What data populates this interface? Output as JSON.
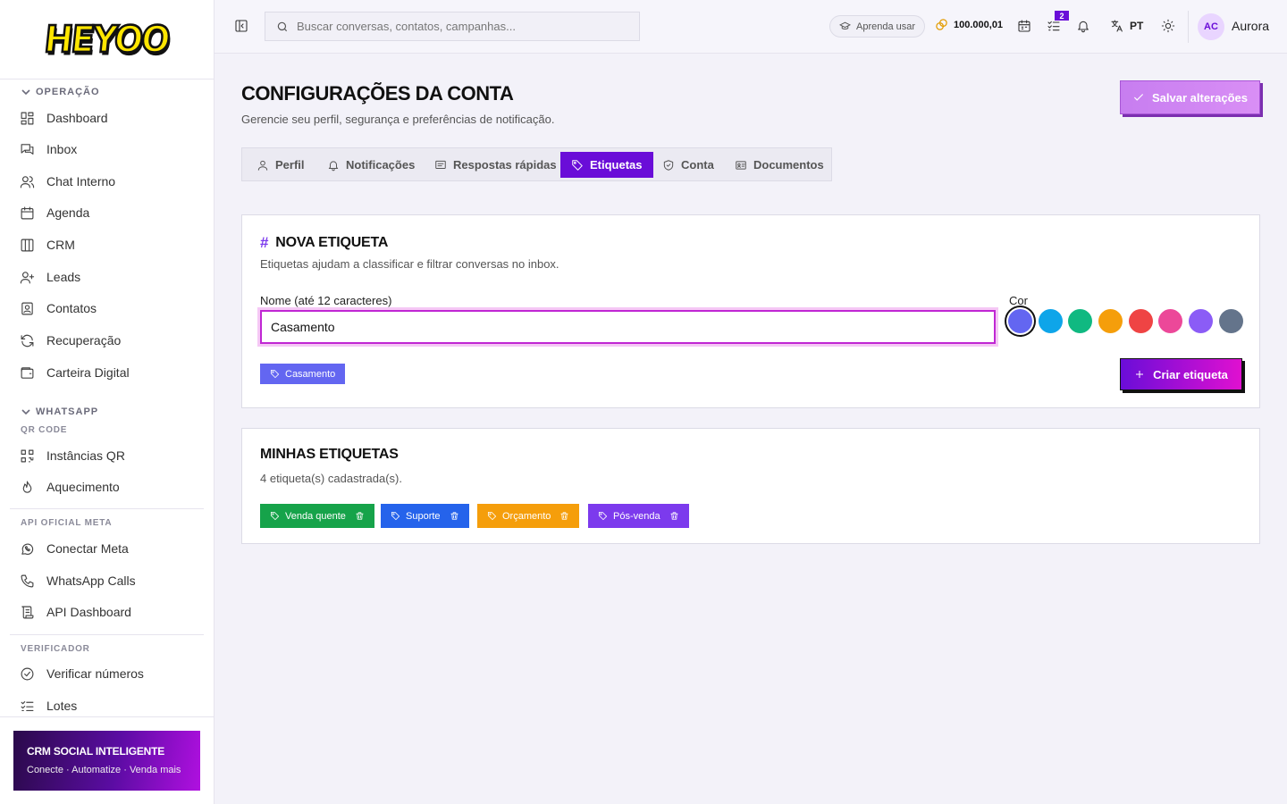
{
  "brand": {
    "logo_text": "HEYOO"
  },
  "sidebar": {
    "sections": {
      "operacao": "OPERAÇÃO",
      "whatsapp": "WHATSAPP",
      "qr_code": "QR CODE",
      "api_oficial": "API OFICIAL META",
      "verificador": "VERIFICADOR"
    },
    "items": {
      "dashboard": "Dashboard",
      "inbox": "Inbox",
      "chat_interno": "Chat Interno",
      "agenda": "Agenda",
      "crm": "CRM",
      "leads": "Leads",
      "contatos": "Contatos",
      "recuperacao": "Recuperação",
      "carteira": "Carteira Digital",
      "instancias": "Instâncias QR",
      "aquecimento": "Aquecimento",
      "conectar_meta": "Conectar Meta",
      "whatsapp_calls": "WhatsApp Calls",
      "api_dashboard": "API Dashboard",
      "verificar": "Verificar números",
      "lotes": "Lotes"
    },
    "promo": {
      "title": "CRM SOCIAL INTELIGENTE",
      "subtitle": "Conecte · Automatize · Venda mais"
    }
  },
  "topbar": {
    "search_placeholder": "Buscar conversas, contatos, campanhas...",
    "learn_label": "Aprenda usar",
    "credits": "100.000,01",
    "tasks_badge": "2",
    "language": "PT",
    "avatar_initials": "AC",
    "username": "Aurora"
  },
  "page": {
    "title": "CONFIGURAÇÕES DA CONTA",
    "subtitle": "Gerencie seu perfil, segurança e preferências de notificação.",
    "save_label": "Salvar alterações"
  },
  "tabs": [
    "Perfil",
    "Notificações",
    "Respostas rápidas",
    "Etiquetas",
    "Conta",
    "Documentos"
  ],
  "active_tab": "Etiquetas",
  "new_tag": {
    "title": "NOVA ETIQUETA",
    "subtitle": "Etiquetas ajudam a classificar e filtrar conversas no inbox.",
    "name_label": "Nome (até 12 caracteres)",
    "name_value": "Casamento",
    "color_label": "Cor",
    "colors": [
      "#6366f1",
      "#0ea5e9",
      "#10b981",
      "#f59e0b",
      "#ef4444",
      "#ec4899",
      "#8b5cf6",
      "#64748b"
    ],
    "selected_color": "#6366f1",
    "preview_label": "Casamento",
    "create_label": "Criar etiqueta"
  },
  "my_tags": {
    "title": "MINHAS ETIQUETAS",
    "count_text": "4 etiqueta(s) cadastrada(s).",
    "tags": [
      {
        "label": "Venda quente",
        "color": "#16a34a"
      },
      {
        "label": "Suporte",
        "color": "#2563eb"
      },
      {
        "label": "Orçamento",
        "color": "#f59e0b"
      },
      {
        "label": "Pós-venda",
        "color": "#7c3aed"
      }
    ]
  }
}
